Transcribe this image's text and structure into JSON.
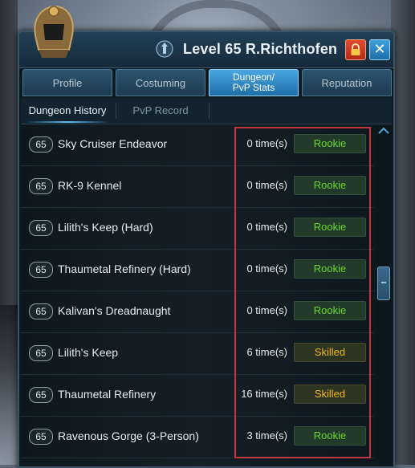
{
  "window": {
    "title": "Level 65 R.Richthofen"
  },
  "tabs": [
    {
      "label": "Profile",
      "active": false
    },
    {
      "label": "Costuming",
      "active": false
    },
    {
      "label": "Dungeon/\nPvP Stats",
      "active": true
    },
    {
      "label": "Reputation",
      "active": false
    }
  ],
  "subtabs": [
    {
      "label": "Dungeon History",
      "active": true
    },
    {
      "label": "PvP Record",
      "active": false
    }
  ],
  "dungeons": [
    {
      "level": "65",
      "name": "Sky Cruiser Endeavor",
      "count": "0 time(s)",
      "rank": "Rookie",
      "rank_color": "#6cd630"
    },
    {
      "level": "65",
      "name": "RK-9 Kennel",
      "count": "0 time(s)",
      "rank": "Rookie",
      "rank_color": "#6cd630"
    },
    {
      "level": "65",
      "name": "Lilith's Keep (Hard)",
      "count": "0 time(s)",
      "rank": "Rookie",
      "rank_color": "#6cd630"
    },
    {
      "level": "65",
      "name": "Thaumetal Refinery (Hard)",
      "count": "0 time(s)",
      "rank": "Rookie",
      "rank_color": "#6cd630"
    },
    {
      "level": "65",
      "name": "Kalivan's Dreadnaught",
      "count": "0 time(s)",
      "rank": "Rookie",
      "rank_color": "#6cd630"
    },
    {
      "level": "65",
      "name": "Lilith's Keep",
      "count": "6 time(s)",
      "rank": "Skilled",
      "rank_color": "#f2b81e"
    },
    {
      "level": "65",
      "name": "Thaumetal Refinery",
      "count": "16 time(s)",
      "rank": "Skilled",
      "rank_color": "#f2b81e"
    },
    {
      "level": "65",
      "name": "Ravenous Gorge (3-Person)",
      "count": "3 time(s)",
      "rank": "Rookie",
      "rank_color": "#6cd630"
    }
  ],
  "colors": {
    "highlight": "#c0363d",
    "accent": "#4aa6e0"
  }
}
